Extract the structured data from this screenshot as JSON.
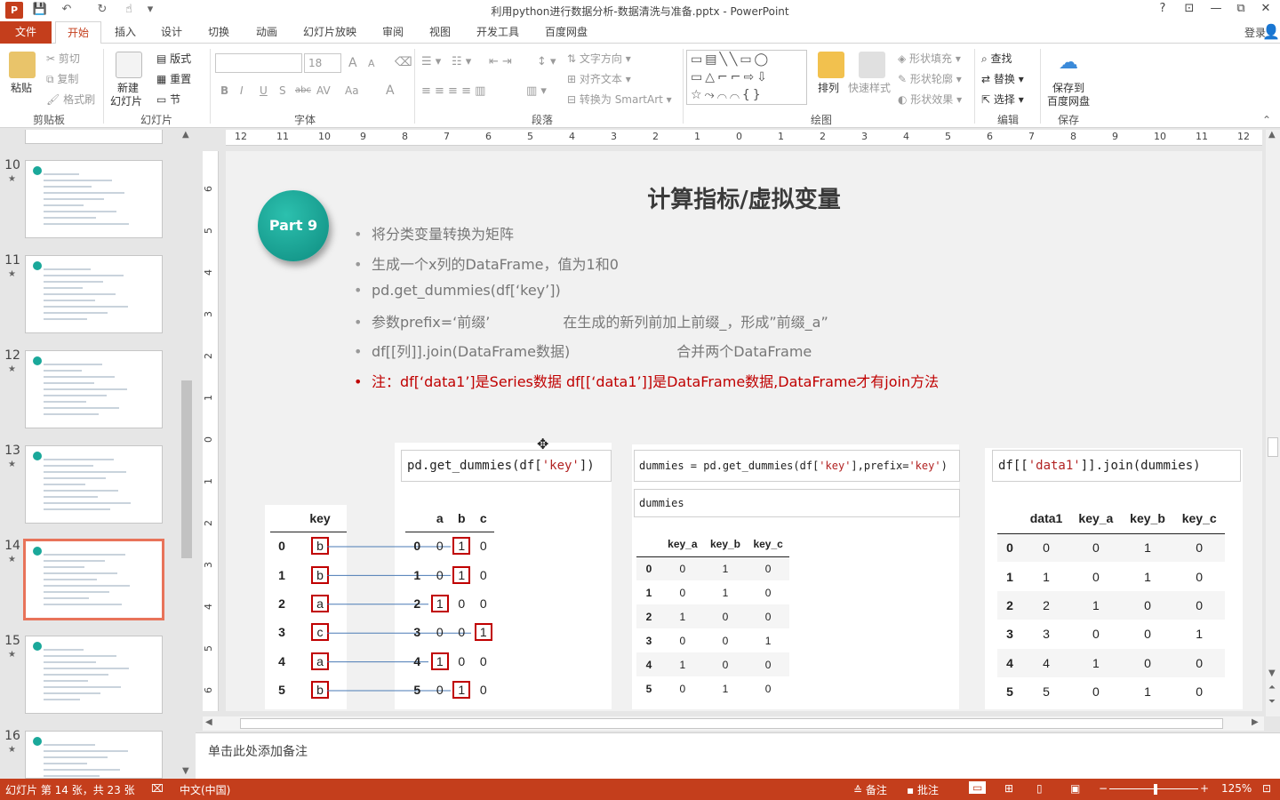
{
  "window": {
    "title": "利用python进行数据分析-数据清洗与准备.pptx - PowerPoint",
    "logo_text": "P",
    "controls": {
      "help": "?",
      "ribbon_display": "⊡",
      "minimize": "—",
      "restore": "⧉",
      "close": "✕"
    },
    "quick_access": {
      "save": "💾",
      "undo": "↶",
      "redo": "↻",
      "touch": "☝",
      "more": "▾"
    }
  },
  "ribbon_tabs": [
    "文件",
    "开始",
    "插入",
    "设计",
    "切换",
    "动画",
    "幻灯片放映",
    "审阅",
    "视图",
    "开发工具",
    "百度网盘"
  ],
  "active_tab": "开始",
  "login": "登录",
  "ribbon": {
    "clipboard": {
      "paste": "粘贴",
      "cut": "剪切",
      "copy": "复制",
      "format_painter": "格式刷",
      "label": "剪贴板"
    },
    "slides": {
      "new_slide": "新建",
      "new_slide2": "幻灯片",
      "layout": "版式",
      "reset": "重置",
      "section": "节",
      "label": "幻灯片"
    },
    "font": {
      "size": "18",
      "bold": "B",
      "italic": "I",
      "underline": "U",
      "shadow": "S",
      "strike": "abc",
      "spacing": "AV",
      "case": "Aa",
      "color": "A",
      "grow": "A",
      "shrink": "A",
      "label": "字体"
    },
    "paragraph": {
      "text_direction": "文字方向",
      "align_text": "对齐文本",
      "smartart": "转换为 SmartArt",
      "label": "段落"
    },
    "drawing": {
      "arrange": "排列",
      "quick_styles": "快速样式",
      "shape_fill": "形状填充",
      "shape_outline": "形状轮廓",
      "shape_effects": "形状效果",
      "label": "绘图"
    },
    "editing": {
      "find": "查找",
      "replace": "替换",
      "select": "选择",
      "label": "编辑"
    },
    "save": {
      "save_to": "保存到",
      "baidu": "百度网盘",
      "label": "保存"
    }
  },
  "thumbnails": [
    {
      "num": "10",
      "star": "★"
    },
    {
      "num": "11",
      "star": "★"
    },
    {
      "num": "12",
      "star": "★"
    },
    {
      "num": "13",
      "star": "★"
    },
    {
      "num": "14",
      "star": "★"
    },
    {
      "num": "15",
      "star": "★"
    },
    {
      "num": "16",
      "star": "★"
    }
  ],
  "selected_thumbnail": "14",
  "ruler_h": [
    "12",
    "11",
    "10",
    "9",
    "8",
    "7",
    "6",
    "5",
    "4",
    "3",
    "2",
    "1",
    "0",
    "1",
    "2",
    "3",
    "4",
    "5",
    "6",
    "7",
    "8",
    "9",
    "10",
    "11",
    "12"
  ],
  "ruler_v": [
    "6",
    "5",
    "4",
    "3",
    "2",
    "1",
    "0",
    "1",
    "2",
    "3",
    "4",
    "5",
    "6"
  ],
  "slide": {
    "badge": "Part 9",
    "title": "计算指标/虚拟变量",
    "bullets": [
      {
        "text": "将分类变量转换为矩阵",
        "extra": ""
      },
      {
        "text": "生成一个x列的DataFrame，值为1和0",
        "extra": ""
      },
      {
        "text": "pd.get_dummies(df[‘key’])",
        "extra": ""
      },
      {
        "text": "参数prefix=‘前缀’",
        "extra": "在生成的新列前加上前缀_，形成”前缀_a”"
      },
      {
        "text": "df[[列]].join(DataFrame数据)",
        "extra": "合并两个DataFrame"
      }
    ],
    "note_bullet": "注：df[‘data1’]是Series数据 df[[‘data1’]]是DataFrame数据,DataFrame才有join方法",
    "bullet_marker": "•",
    "code1": {
      "pre": "pd.get_dummies(df[",
      "str": "'key'",
      "post": "])"
    },
    "code2": {
      "pre": "dummies = pd.get_dummies(df[",
      "str1": "'key'",
      "mid": "],prefix=",
      "str2": "'key'",
      "post": ")"
    },
    "code3": "dummies",
    "code4": {
      "pre": "df[[",
      "str": "'data1'",
      "post": "]].join(dummies)"
    },
    "key_table": {
      "header": "key",
      "rows": [
        [
          "0",
          "b"
        ],
        [
          "1",
          "b"
        ],
        [
          "2",
          "a"
        ],
        [
          "3",
          "c"
        ],
        [
          "4",
          "a"
        ],
        [
          "5",
          "b"
        ]
      ]
    },
    "dummy_table": {
      "headers": [
        "a",
        "b",
        "c"
      ],
      "rows": [
        [
          "0",
          "0",
          "1",
          "0"
        ],
        [
          "1",
          "0",
          "1",
          "0"
        ],
        [
          "2",
          "1",
          "0",
          "0"
        ],
        [
          "3",
          "0",
          "0",
          "1"
        ],
        [
          "4",
          "1",
          "0",
          "0"
        ],
        [
          "5",
          "0",
          "1",
          "0"
        ]
      ],
      "boxed_col": [
        2,
        2,
        1,
        3,
        1,
        2
      ]
    },
    "prefix_table": {
      "headers": [
        "key_a",
        "key_b",
        "key_c"
      ],
      "rows": [
        [
          "0",
          "0",
          "1",
          "0"
        ],
        [
          "1",
          "0",
          "1",
          "0"
        ],
        [
          "2",
          "1",
          "0",
          "0"
        ],
        [
          "3",
          "0",
          "0",
          "1"
        ],
        [
          "4",
          "1",
          "0",
          "0"
        ],
        [
          "5",
          "0",
          "1",
          "0"
        ]
      ]
    },
    "join_table": {
      "headers": [
        "data1",
        "key_a",
        "key_b",
        "key_c"
      ],
      "rows": [
        [
          "0",
          "0",
          "0",
          "1",
          "0"
        ],
        [
          "1",
          "1",
          "0",
          "1",
          "0"
        ],
        [
          "2",
          "2",
          "1",
          "0",
          "0"
        ],
        [
          "3",
          "3",
          "0",
          "0",
          "1"
        ],
        [
          "4",
          "4",
          "1",
          "0",
          "0"
        ],
        [
          "5",
          "5",
          "0",
          "1",
          "0"
        ]
      ]
    }
  },
  "notes_placeholder": "单击此处添加备注",
  "status": {
    "slide_info": "幻灯片 第 14 张，共 23 张",
    "language": "中文(中国)",
    "notes": "备注",
    "comments": "批注",
    "zoom": "125%"
  }
}
